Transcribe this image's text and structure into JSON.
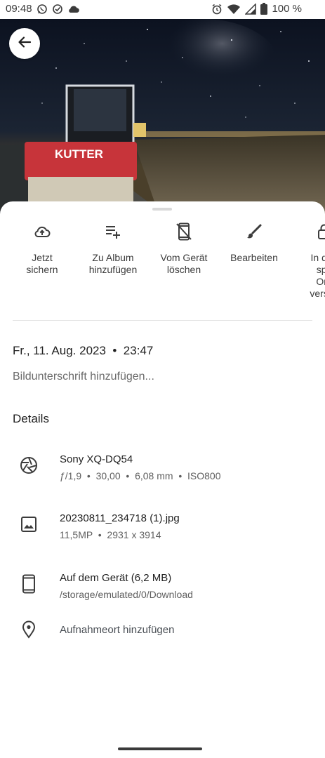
{
  "status_bar": {
    "time": "09:48",
    "left_icons": [
      "whatsapp-icon",
      "check-circle-icon",
      "cloud-icon"
    ],
    "right_icons": [
      "alarm-icon",
      "wifi-icon",
      "signal-icon",
      "battery-icon"
    ],
    "battery": "100 %"
  },
  "photo": {
    "sign_text": "KUTTER"
  },
  "actions": [
    {
      "label": "Jetzt\nsichern",
      "icon": "cloud-upload-icon"
    },
    {
      "label": "Zu Album\nhinzufügen",
      "icon": "playlist-add-icon"
    },
    {
      "label": "Vom Gerät\nlöschen",
      "icon": "phone-delete-icon"
    },
    {
      "label": "Bearbeiten",
      "icon": "brush-icon"
    },
    {
      "label": "In den\nspe\nOrd\nversch",
      "icon": "lock-icon"
    }
  ],
  "info": {
    "datetime": "Fr., 11. Aug. 2023  •  23:47",
    "caption_placeholder": "Bildunterschrift hinzufügen...",
    "details_heading": "Details"
  },
  "details": {
    "camera": {
      "title": "Sony XQ-DQ54",
      "sub": "ƒ/1,9  •  30,00  •  6,08 mm  •  ISO800",
      "icon": "aperture-icon"
    },
    "file": {
      "title": "20230811_234718 (1).jpg",
      "sub": "11,5MP  •  2931 x 3914",
      "icon": "image-icon"
    },
    "storage": {
      "title": "Auf dem Gerät (6,2 MB)",
      "sub": "/storage/emulated/0/Download",
      "icon": "smartphone-icon"
    },
    "location": {
      "title": "Aufnahmeort hinzufügen",
      "icon": "location-pin-icon"
    }
  }
}
